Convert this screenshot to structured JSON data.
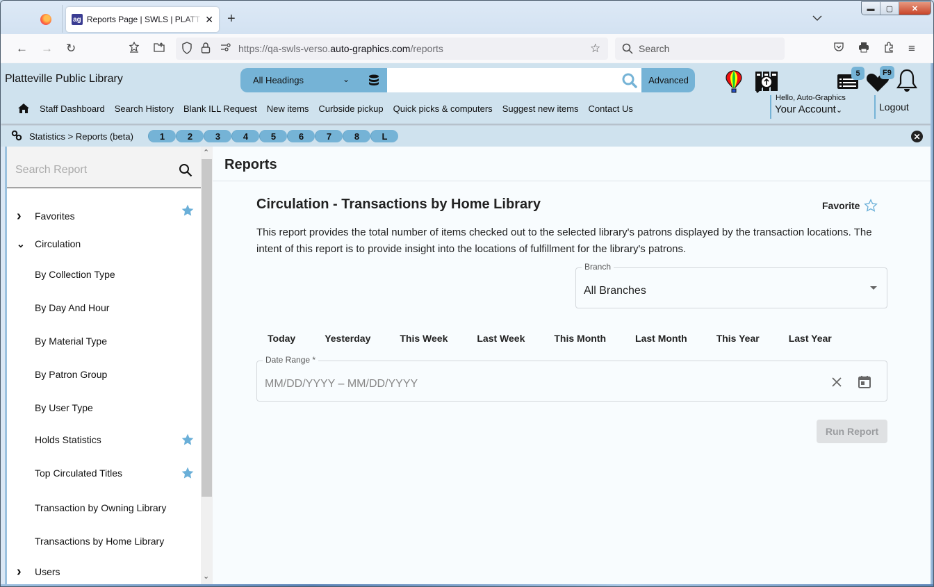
{
  "browser": {
    "tab_title": "Reports Page | SWLS | PLATT | Auto-Graphics",
    "url_prefix": "https://qa-swls-verso.",
    "url_domain": "auto-graphics.com",
    "url_path": "/reports",
    "search_placeholder": "Search",
    "favicon_text": "ag"
  },
  "header": {
    "library_name": "Platteville Public Library",
    "search_scope": "All Headings",
    "search_value": "",
    "advanced_label": "Advanced",
    "list_badge": "5",
    "heart_badge": "F9",
    "hello_text": "Hello, Auto-Graphics",
    "account_label": "Your Account",
    "logout_label": "Logout",
    "nav_items": [
      "Staff Dashboard",
      "Search History",
      "Blank ILL Request",
      "New items",
      "Curbside pickup",
      "Quick picks & computers",
      "Suggest new items",
      "Contact Us"
    ]
  },
  "breadcrumb": {
    "text": "Statistics > Reports (beta)",
    "pills": [
      "1",
      "2",
      "3",
      "4",
      "5",
      "6",
      "7",
      "8",
      "L"
    ]
  },
  "sidebar": {
    "search_placeholder": "Search Report",
    "items": [
      {
        "label": "Favorites",
        "level": 0,
        "expanded": false,
        "starred": true
      },
      {
        "label": "Circulation",
        "level": 0,
        "expanded": true,
        "starred": false
      },
      {
        "label": "By Collection Type",
        "level": 1,
        "starred": false
      },
      {
        "label": "By Day And Hour",
        "level": 1,
        "starred": false
      },
      {
        "label": "By Material Type",
        "level": 1,
        "starred": false
      },
      {
        "label": "By Patron Group",
        "level": 1,
        "starred": false
      },
      {
        "label": "By User Type",
        "level": 1,
        "starred": false
      },
      {
        "label": "Holds Statistics",
        "level": 1,
        "starred": true
      },
      {
        "label": "Top Circulated Titles",
        "level": 1,
        "starred": true
      },
      {
        "label": "Transaction by Owning Library",
        "level": 1,
        "starred": false
      },
      {
        "label": "Transactions by Home Library",
        "level": 1,
        "starred": false
      },
      {
        "label": "Users",
        "level": 0,
        "expanded": false,
        "starred": false
      }
    ]
  },
  "main": {
    "title": "Reports",
    "report_title": "Circulation - Transactions by Home Library",
    "favorite_label": "Favorite",
    "description": "This report provides the total number of items checked out to the selected library's patrons displayed by the transaction locations. The intent of this report is to provide insight into the locations of fulfillment for the library's patrons.",
    "branch_label": "Branch",
    "branch_value": "All Branches",
    "quick_dates": [
      "Today",
      "Yesterday",
      "This Week",
      "Last Week",
      "This Month",
      "Last Month",
      "This Year",
      "Last Year"
    ],
    "date_range_label": "Date Range *",
    "date_range_placeholder": "MM/DD/YYYY – MM/DD/YYYY",
    "run_label": "Run Report"
  },
  "colors": {
    "accent": "#75b3d6",
    "header_bg": "#cfe2ee",
    "star": "#6aafd8"
  }
}
